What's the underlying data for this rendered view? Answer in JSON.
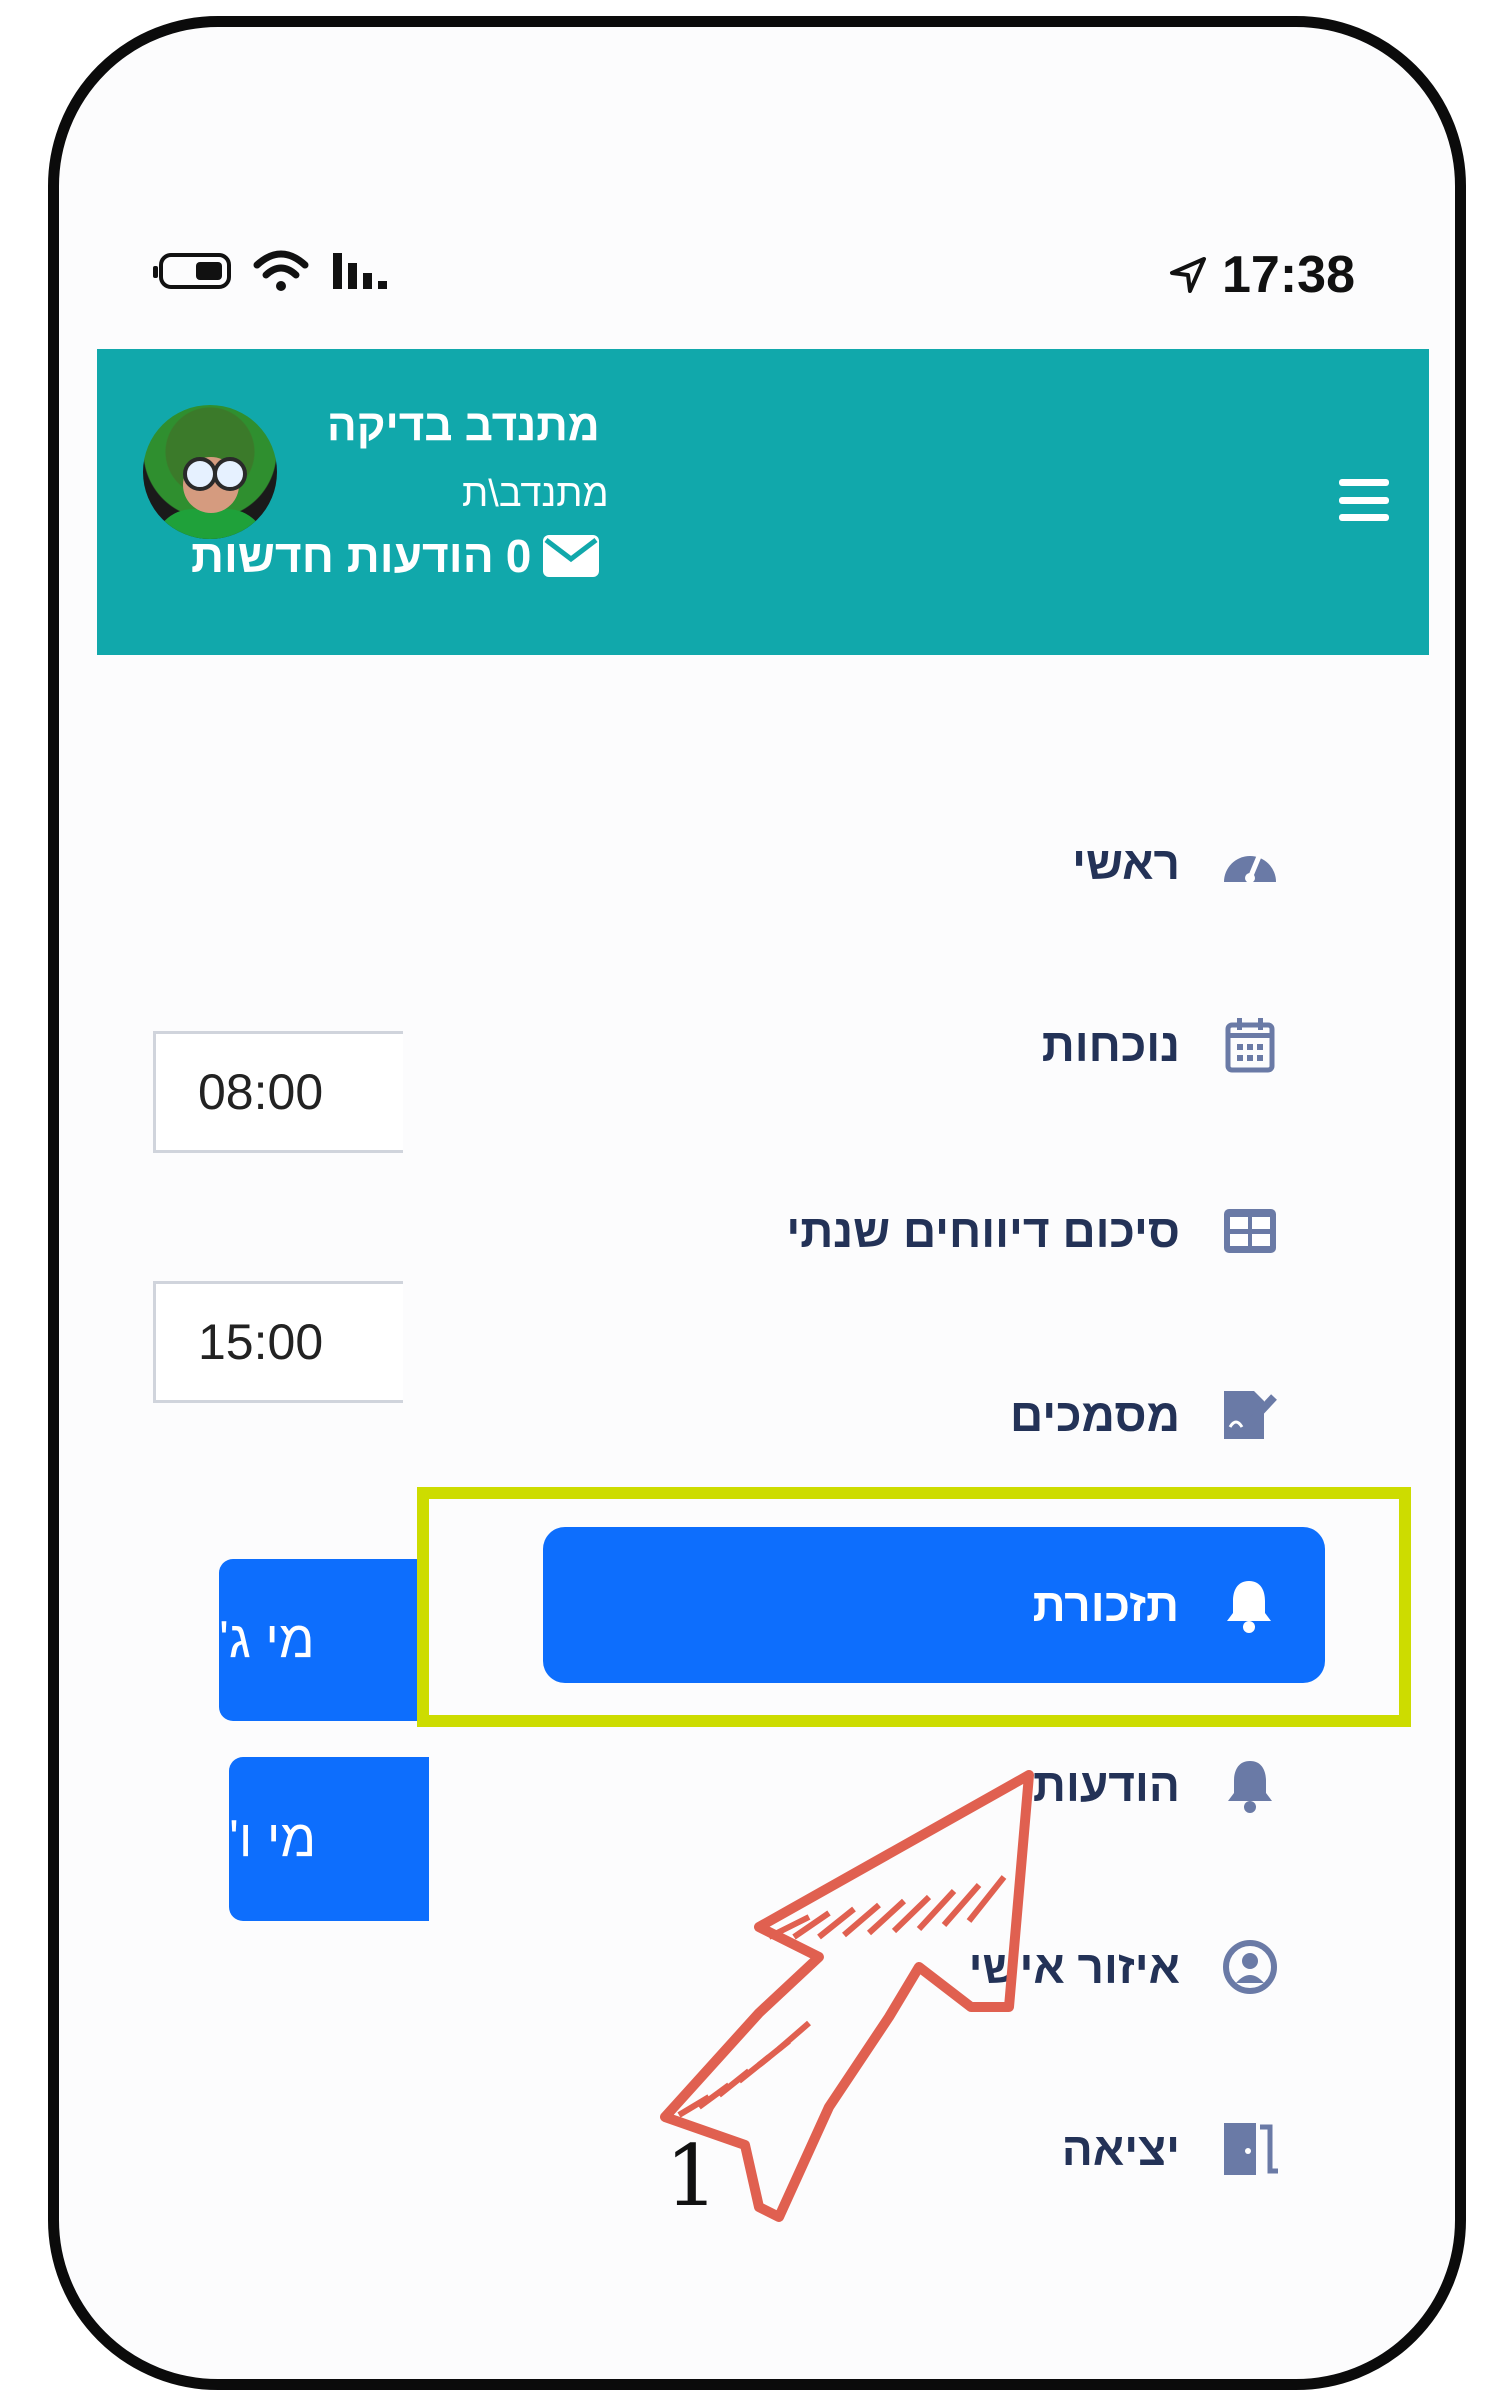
{
  "status_bar": {
    "time": "17:38"
  },
  "header": {
    "user_name": "מתנדב בדיקה",
    "user_role": "מתנדב\\ת",
    "messages_count": "0",
    "messages_label": "הודעות חדשות"
  },
  "background": {
    "time_start": "08:00",
    "time_end": "15:00",
    "day_btn_1": "מי ג'",
    "day_btn_2": "מי ו'"
  },
  "menu": {
    "items": [
      {
        "label": "ראשי",
        "icon": "dashboard-icon"
      },
      {
        "label": "נוכחות",
        "icon": "calendar-icon"
      },
      {
        "label": "סיכום דיווחים שנתי",
        "icon": "table-icon"
      },
      {
        "label": "מסמכים",
        "icon": "document-sign-icon"
      },
      {
        "label": "תזכורת",
        "icon": "bell-icon",
        "active": true
      },
      {
        "label": "הודעות",
        "icon": "bell-icon"
      },
      {
        "label": "איזור אישי",
        "icon": "user-circle-icon"
      },
      {
        "label": "יציאה",
        "icon": "door-exit-icon"
      }
    ]
  },
  "annotation": {
    "number": "1",
    "highlight_color": "#cddc00",
    "arrow_color": "#e06050"
  },
  "colors": {
    "header": "#11a8ab",
    "active": "#0d6efd",
    "menu_text": "#233257"
  }
}
